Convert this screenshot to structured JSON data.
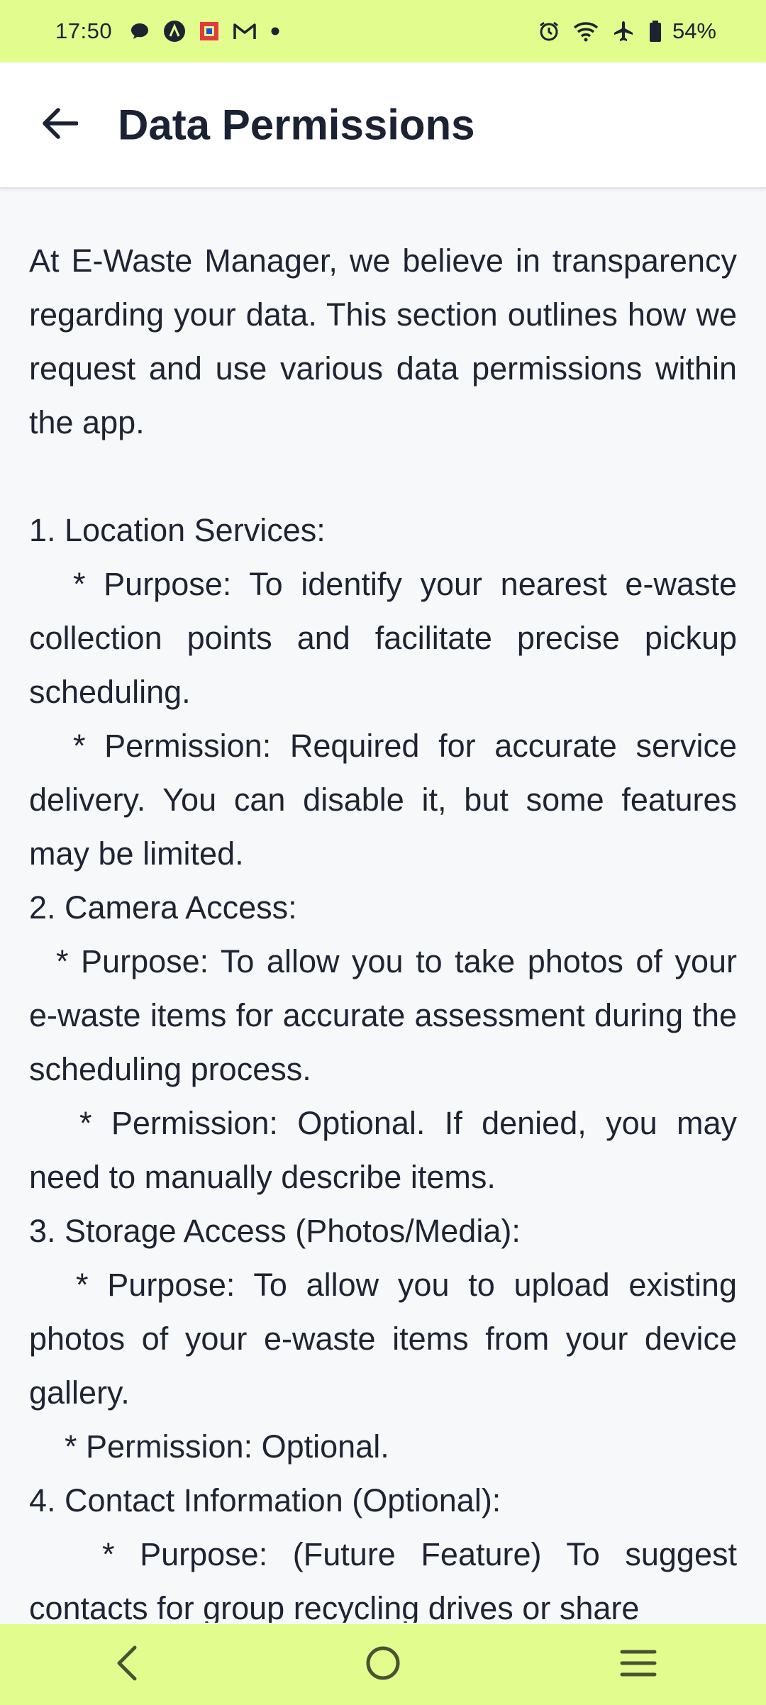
{
  "status_bar": {
    "time": "17:50",
    "battery": "54%",
    "left_icons": [
      "chat-bubble-icon",
      "a-badge-icon",
      "square-app-icon",
      "gmail-icon",
      "dot-icon"
    ],
    "right_icons": [
      "alarm-icon",
      "wifi-icon",
      "airplane-icon",
      "battery-icon"
    ]
  },
  "app_bar": {
    "title": "Data Permissions",
    "back_icon": "back-arrow-icon"
  },
  "content": {
    "intro": "At E-Waste Manager, we believe in transparency regarding your data. This section outlines how we request and use various data permissions within the app.",
    "items": [
      {
        "heading": "1.  Location Services:",
        "purpose": "* Purpose: To identify your nearest e-waste collection points and facilitate precise pickup scheduling.",
        "permission": "* Permission: Required for accurate service delivery. You can disable it, but some features may be limited."
      },
      {
        "heading": "2.  Camera Access:",
        "purpose": "* Purpose: To allow you to take photos of your e-waste items for accurate assessment during the scheduling process.",
        "permission": "* Permission: Optional. If denied, you may need to manually describe items."
      },
      {
        "heading": "3.  Storage Access (Photos/Media):",
        "purpose": "* Purpose: To allow you to upload existing photos of your e-waste items from your device gallery.",
        "permission": "* Permission: Optional."
      },
      {
        "heading": "4.  Contact Information (Optional):",
        "purpose": "* Purpose: (Future Feature) To suggest contacts for group recycling drives or share"
      }
    ]
  },
  "nav_bar": {
    "buttons": [
      "nav-back-icon",
      "nav-home-icon",
      "nav-menu-icon"
    ]
  },
  "colors": {
    "bars": "#e2fc8e",
    "background": "#f7f8fa",
    "text": "#1f2433"
  }
}
